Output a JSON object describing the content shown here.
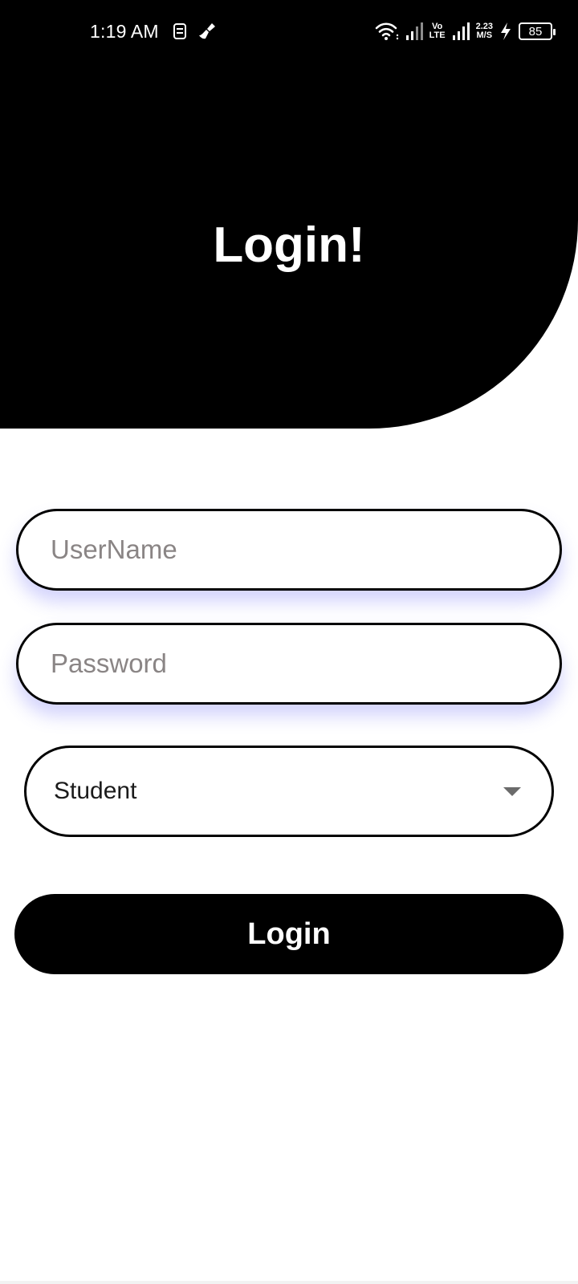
{
  "status_bar": {
    "time": "1:19 AM",
    "icons_left": [
      "sim-manager-icon",
      "cleaner-brush-icon"
    ],
    "icons_right": [
      "wifi-icon",
      "signal-icon",
      "volte-icon",
      "signal-icon",
      "network-speed-icon",
      "charging-icon",
      "battery-icon"
    ],
    "volte_top": "Vo",
    "volte_bottom": "LTE",
    "speed_value": "2.23",
    "speed_unit": "M/S",
    "battery_level": "85"
  },
  "header": {
    "title": "Login!"
  },
  "form": {
    "username_placeholder": "UserName",
    "password_placeholder": "Password",
    "role_selected": "Student",
    "login_label": "Login"
  },
  "colors": {
    "primary": "#000000",
    "background": "#ffffff",
    "placeholder": "#8a8585",
    "field_shadow": "#6e6ef5"
  }
}
